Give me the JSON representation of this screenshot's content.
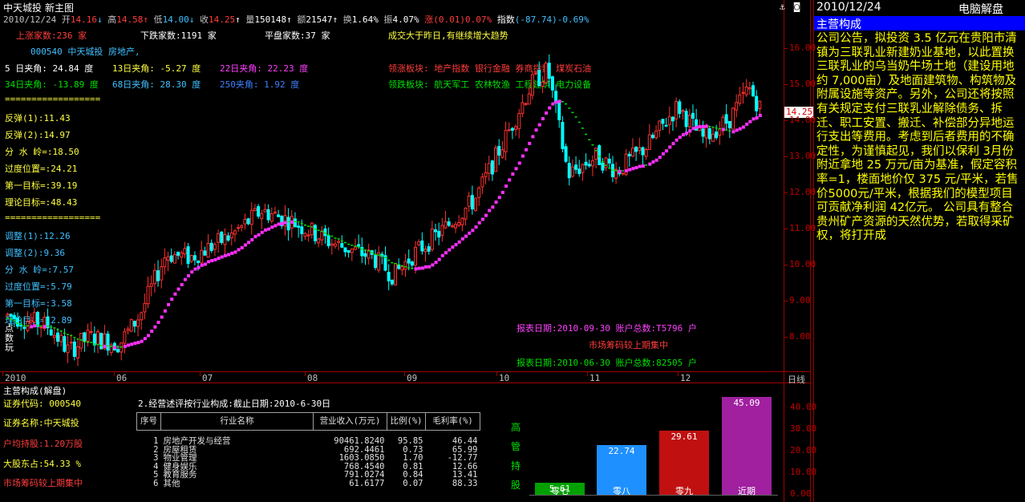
{
  "topbar": {
    "stock": "中天城投",
    "view": "新主图"
  },
  "quote": {
    "date": "2010/12/24",
    "open_l": "开",
    "open": "14.16",
    "high_l": "高",
    "high": "14.58",
    "low_l": "低",
    "low": "14.00",
    "close_l": "收",
    "close": "14.25",
    "vol_l": "量",
    "vol": "150148",
    "amt_l": "额",
    "amt": "21547",
    "turn_l": "换",
    "turn": "1.64%",
    "amp_l": "振",
    "amp": "4.07%",
    "chg_l": "涨",
    "chg": "(0.01)",
    "chgp": "0.07%",
    "idx_l": "指数",
    "idx": "(-87.74)-0.69%"
  },
  "market": {
    "up": "上涨家数:236 家",
    "down": "下跌家数:1191 家",
    "flat": "平盘家数:37 家",
    "note": "成交大于昨日,有继续增大趋势"
  },
  "stockinfo": {
    "code_name": "000540 中天城投 房地产,"
  },
  "angles": {
    "a5": "5 日夹角: 24.84 度",
    "a13": "13日夹角: -5.27 度",
    "a22": "22日夹角: 22.23 度",
    "a34": "34日夹角: -13.89 度",
    "a68": "68日夹角: 28.30 度",
    "a250": "250夹角: 1.92 度"
  },
  "sectors": {
    "lead_up": "领涨板块: 地产指数  银行金融  券商指数  煤炭石油",
    "lead_down": "领跌板块: 航天军工  农林牧渔  工程建筑  电力设备"
  },
  "levels": {
    "sep1": "==================",
    "r1": "反弹(1):11.43",
    "r2": "反弹(2):14.97",
    "ridge": "分 水 岭=:18.50",
    "over": "过度位置=:24.21",
    "t1": "第一目标=:39.19",
    "theory": "理论目标=:48.43",
    "sep2": "==================",
    "a1": "调整(1):12.26",
    "a2": "调整(2):9.36",
    "ridge2": "分 水 岭=:7.57",
    "over2": "过度位置=:5.79",
    "t12": "第一目标=:3.58",
    "theory2": "理论目标=:2.89",
    "ts1": "点",
    "ts2": "数",
    "ts3": "玩"
  },
  "yaxis": [
    "16.00",
    "15.00",
    "14.00",
    "13.00",
    "12.00",
    "11.00",
    "10.00",
    "9.00",
    "8.00"
  ],
  "price_tag": "14.25",
  "xaxis": {
    "labels": [
      "2010",
      "06",
      "07",
      "08",
      "09",
      "10",
      "11",
      "12"
    ],
    "unit": "日线"
  },
  "report": {
    "r1": "报表日期:2010-09-30 账户总数:T5796 户",
    "r2": "市场筹码较上期集中",
    "r3": "报表日期:2010-06-30 账户总数:82505 户"
  },
  "bottom": {
    "title": "主营构成(解盘)",
    "code": "证券代码: 000540",
    "name": "证券名称:中天城投",
    "avg": "户均持股:1.20万股",
    "holder": "大股东占:54.33 %",
    "chip": "市场筹码较上期集中",
    "table_title": "2.经营述评按行业构成:截止日期:2010-6-30日",
    "headers": [
      "序号",
      "行业名称",
      "营业收入(万元)",
      "比例(%)",
      "毛利率(%)"
    ],
    "rows": [
      [
        "1",
        "房地产开发与经营",
        "90461.8240",
        "95.85",
        "46.44"
      ],
      [
        "2",
        "房屋租赁",
        "692.4461",
        "0.73",
        "65.99"
      ],
      [
        "3",
        "物业管理",
        "1603.0850",
        "1.70",
        "-12.77"
      ],
      [
        "4",
        "健身娱乐",
        "768.4540",
        "0.81",
        "12.66"
      ],
      [
        "5",
        "教育服务",
        "791.0274",
        "0.84",
        "13.41"
      ],
      [
        "6",
        "其他",
        "61.6177",
        "0.07",
        "88.33"
      ]
    ],
    "side": [
      "高",
      "管",
      "持",
      "股"
    ]
  },
  "chart_data": {
    "type": "bar",
    "categories": [
      "零七",
      "零八",
      "零九",
      "近期"
    ],
    "values": [
      5.61,
      22.74,
      29.61,
      45.09
    ],
    "colors": [
      "#00a000",
      "#1e90ff",
      "#c01010",
      "#a020a0"
    ],
    "ylim": [
      0,
      50
    ],
    "yticks": [
      "40.00",
      "30.00",
      "20.00",
      "10.00",
      "0.00"
    ]
  },
  "rightpanel": {
    "date": "2010/12/24",
    "right": "电脑解盘",
    "title": "主营构成",
    "body": "公司公告，拟投资 3.5 亿元在贵阳市清镇为三联乳业新建奶业基地，以此置换三联乳业的乌当奶牛场土地（建设用地约 7,000亩）及地面建筑物、构筑物及附属设施等资产。另外，公司还将按照有关规定支付三联乳业解除债务、拆迁、职工安置、搬迁、补偿部分异地运行支出等费用。考虑到后者费用的不确定性，为谨慎起见，我们以保利 3月份附近拿地 25 万元/亩为基准，假定容积率=1，楼面地价仅 375 元/平米，若售价5000元/平米，根据我们的模型项目可贡献净利润 42亿元。  公司具有整合贵州矿产资源的天然优势，若取得采矿权，将打开成"
  }
}
